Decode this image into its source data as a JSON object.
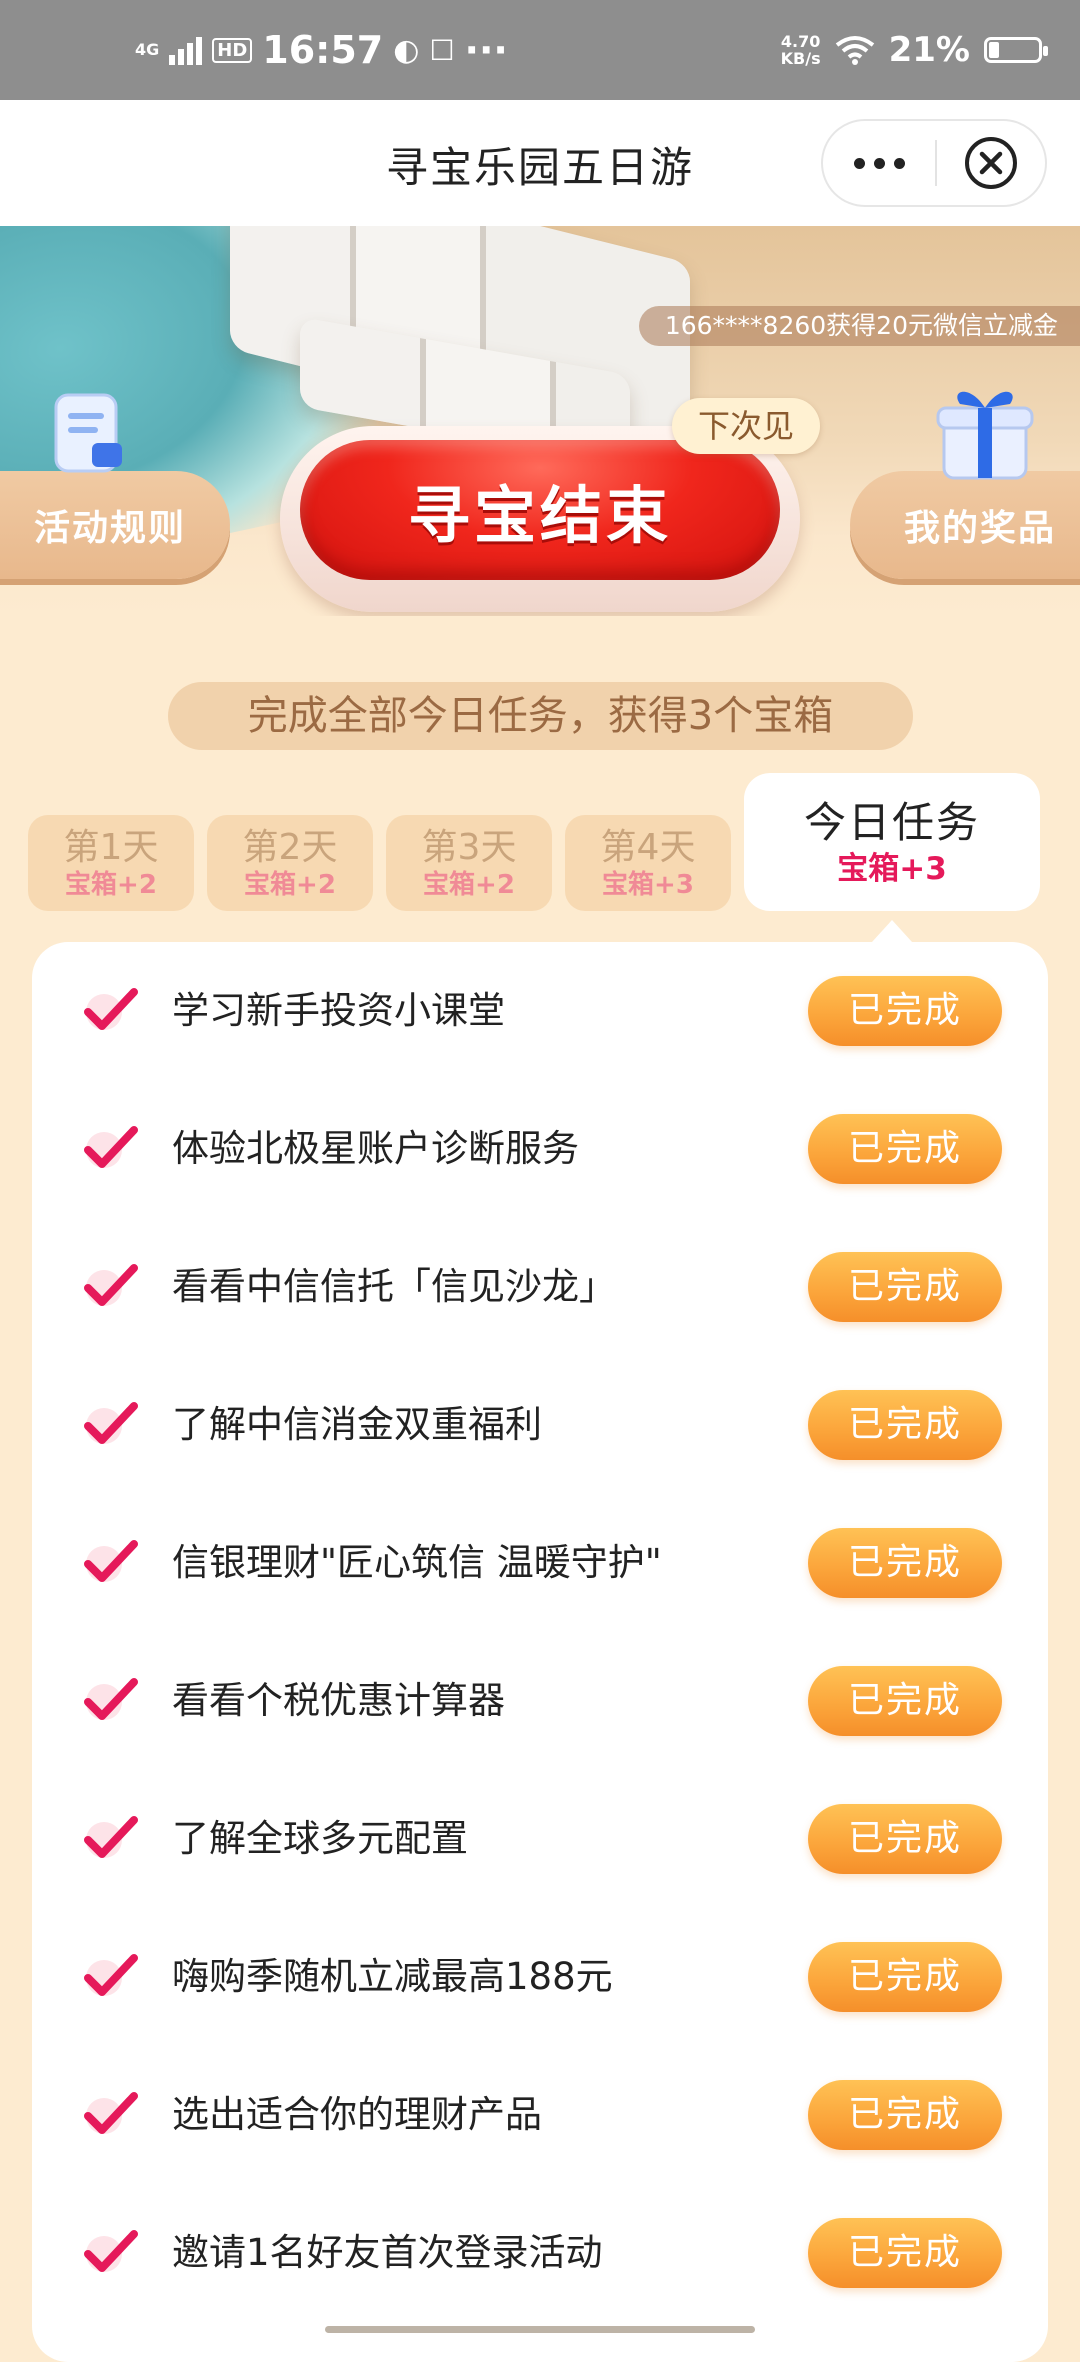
{
  "status_bar": {
    "network": "4G",
    "hd": "HD",
    "time": "16:57",
    "more": "···",
    "speed_value": "4.70",
    "speed_unit": "KB/s",
    "battery": "21%"
  },
  "title_bar": {
    "title": "寻宝乐园五日游",
    "more_icon": "ellipsis-icon",
    "close_icon": "close-circle-icon"
  },
  "hero": {
    "ticker": "166****8260获得20元微信立减金",
    "rules_label": "活动规则",
    "prize_label": "我的奖品",
    "main_button": "寻宝结束",
    "next_tag": "下次见"
  },
  "subtitle": "完成全部今日任务，获得3个宝箱",
  "tabs": [
    {
      "day": "第1天",
      "reward": "宝箱+2"
    },
    {
      "day": "第2天",
      "reward": "宝箱+2"
    },
    {
      "day": "第3天",
      "reward": "宝箱+2"
    },
    {
      "day": "第4天",
      "reward": "宝箱+3"
    }
  ],
  "today_tab": {
    "label": "今日任务",
    "reward": "宝箱+3"
  },
  "tasks": [
    {
      "label": "学习新手投资小课堂",
      "status": "已完成"
    },
    {
      "label": "体验北极星账户诊断服务",
      "status": "已完成"
    },
    {
      "label": "看看中信信托「信见沙龙」",
      "status": "已完成"
    },
    {
      "label": "了解中信消金双重福利",
      "status": "已完成"
    },
    {
      "label": "信银理财\"匠心筑信 温暖守护\"",
      "status": "已完成"
    },
    {
      "label": "看看个税优惠计算器",
      "status": "已完成"
    },
    {
      "label": "了解全球多元配置",
      "status": "已完成"
    },
    {
      "label": "嗨购季随机立减最高188元",
      "status": "已完成"
    },
    {
      "label": "选出适合你的理财产品",
      "status": "已完成"
    },
    {
      "label": "邀请1名好友首次登录活动",
      "status": "已完成"
    }
  ],
  "colors": {
    "accent_red": "#f0261c",
    "done_orange": "#fba43a",
    "check_red": "#e5195a",
    "page_bg": "#fdebd0"
  }
}
